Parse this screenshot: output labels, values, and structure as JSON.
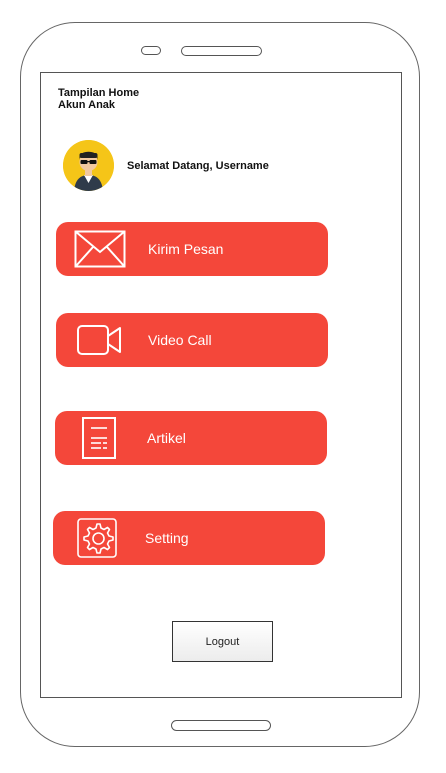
{
  "screen": {
    "title_line1": "Tampilan Home",
    "title_line2": "Akun Anak",
    "welcome_text": "Selamat Datang, Username"
  },
  "avatar": {
    "icon": "user-sunglasses-avatar",
    "background_color": "#f5c518"
  },
  "menu": {
    "accent_color": "#f4473a",
    "items": [
      {
        "label": "Kirim Pesan",
        "icon": "envelope-icon"
      },
      {
        "label": "Video Call",
        "icon": "video-camera-icon"
      },
      {
        "label": "Artikel",
        "icon": "document-icon"
      },
      {
        "label": "Setting",
        "icon": "gear-icon"
      }
    ]
  },
  "logout": {
    "label": "Logout"
  }
}
